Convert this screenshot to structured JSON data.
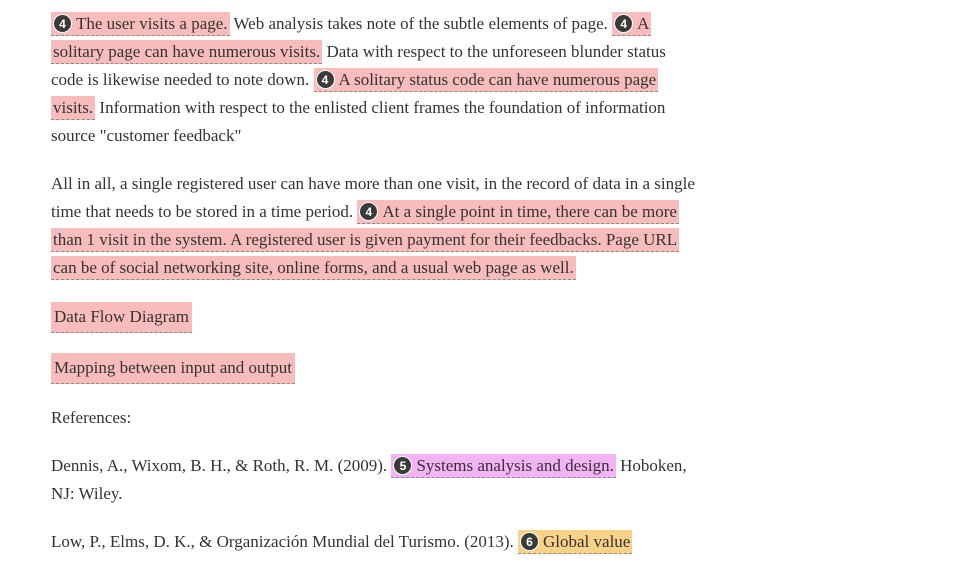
{
  "colors": {
    "highlight_4": "#f8bcbc",
    "highlight_5": "#f4b3f4",
    "highlight_6": "#f9d287",
    "badge": "#3a3a3a"
  },
  "para1": {
    "hl1_badge": "4",
    "hl1_text": "The user visits a page.",
    "t1": " Web analysis takes note of the subtle elements of page. ",
    "hl2_badge": "4",
    "hl2_text": "A solitary page can have numerous visits.",
    "t2": " Data with respect to the unforeseen blunder status code is likewise needed to note down. ",
    "hl3_badge": "4",
    "hl3_text": "A solitary status code can have numerous page visits.",
    "t3": " Information with respect to the enlisted client frames the foundation of information source \"customer feedback\""
  },
  "para2": {
    "t1": "All in all, a single registered user can have more than one visit, in the record of data in a single time that needs to be stored in a time period. ",
    "hl_badge": "4",
    "hl_text": "At a single point in time, there can be more than 1 visit in the system.  A registered user is given payment for their feedbacks.  Page URL can be of social networking site, online forms, and a usual web page as well."
  },
  "para3": {
    "text": "Data Flow Diagram"
  },
  "para4": {
    "text": "Mapping between input and output"
  },
  "para5": {
    "text": "References:"
  },
  "ref1": {
    "t1": "Dennis, A., Wixom, B. H., & Roth, R. M. (2009). ",
    "hl_badge": "5",
    "hl_text": "Systems analysis and design.",
    "t2": " Hoboken, NJ: Wiley."
  },
  "ref2": {
    "t1": "Low, P., Elms, D. K., & Organización Mundial del Turismo. (2013). ",
    "hl_badge": "6",
    "hl_text": "Global value"
  }
}
